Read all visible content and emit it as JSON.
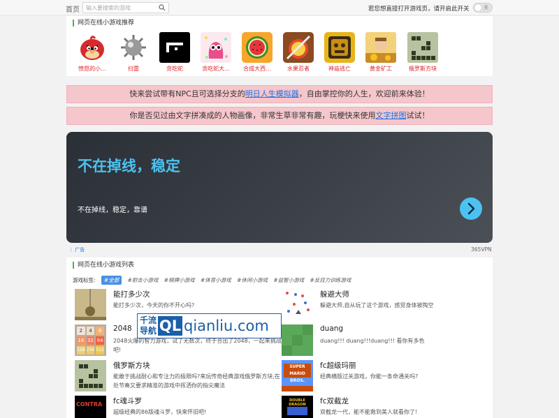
{
  "topbar": {
    "home": "首页",
    "search_placeholder": "输入要搜索的游戏",
    "direct_open_text": "若您想直接打开游戏页，请开启此开关",
    "toggle_label": "关"
  },
  "recommend": {
    "title": "网页在线小游戏推荐",
    "items": [
      {
        "label": "愤怒的小..."
      },
      {
        "label": "扫雷"
      },
      {
        "label": "贪吃蛇"
      },
      {
        "label": "贪吃蛇大..."
      },
      {
        "label": "合成大西..."
      },
      {
        "label": "水果忍者"
      },
      {
        "label": "神庙逃亡"
      },
      {
        "label": "黄金矿工"
      },
      {
        "label": "俄罗斯方块"
      }
    ]
  },
  "promos": [
    {
      "before": "快来尝试带有NPC且可选择分支的",
      "link": "明日人生模拟器",
      "after": "，自由掌控你的人生，欢迎前来体验！"
    },
    {
      "before": "你是否见过由文字拼凑成的人物画像，非常生草非常有趣，玩梗快来使用",
      "link": "文字拼图",
      "after": "试试！"
    }
  ],
  "ad": {
    "title": "不在掉线，稳定",
    "subtitle": "不在掉线，稳定，靠谱",
    "footer_left": "⋮ 广告",
    "footer_right": "365VPN"
  },
  "gamelist": {
    "title": "网页在线小游戏列表",
    "tags_label": "游戏标签:",
    "tags": [
      "#全部",
      "#射击小游戏",
      "#棋牌小游戏",
      "#体育小游戏",
      "#休闲小游戏",
      "#益智小游戏",
      "#反应力训练游戏"
    ],
    "games": [
      {
        "name": "能打多少次",
        "desc": "能打多少次，今天的你不开心吗?"
      },
      {
        "name": "躲避大师",
        "desc": "躲避大师,自从玩了这个游戏，感觉身体被掏空"
      },
      {
        "name": "2048",
        "desc": "2048火爆的智力游戏，试了无数次，终于合出了2048，一起来挑战吧!"
      },
      {
        "name": "duang",
        "desc": "duang!!! duang!!!duang!!! 看你有多色"
      },
      {
        "name": "俄罗斯方块",
        "desc": "能敢于挑战耐心和专注力的极限吗?来玩传奇经典游戏俄罗斯方块,在处节奏又要求精准的游戏中挥洒你的指尖魔法"
      },
      {
        "name": "fc超级玛丽",
        "desc": "经典横版过关游戏，你能一条命通关吗?"
      },
      {
        "name": "fc魂斗罗",
        "desc": "超级经典的86版魂斗罗，快来怀旧吧!"
      },
      {
        "name": "fc双截龙",
        "desc": "双截龙一代，能不能救到美人就看你了!"
      }
    ]
  },
  "watermark": {
    "cn_line1": "千流",
    "cn_line2": "导航",
    "logo": "QL",
    "url": "qianliu.com"
  },
  "thumb_text": {
    "g2048": [
      "2",
      "4",
      "8",
      "16",
      "32",
      "64",
      "128",
      "256",
      "512"
    ],
    "mario": "SUPER MARIO BROS.",
    "contra": "CONTRA",
    "dragon": "DOUBLE DRAGON"
  },
  "colors": {
    "accent_green": "#4caf50",
    "link_blue": "#1a73e8",
    "promo_pink": "#f5c6cb",
    "ad_cyan": "#4cc2f1",
    "rec_label_red": "#e0232a",
    "tag_active": "#4a90e2"
  }
}
